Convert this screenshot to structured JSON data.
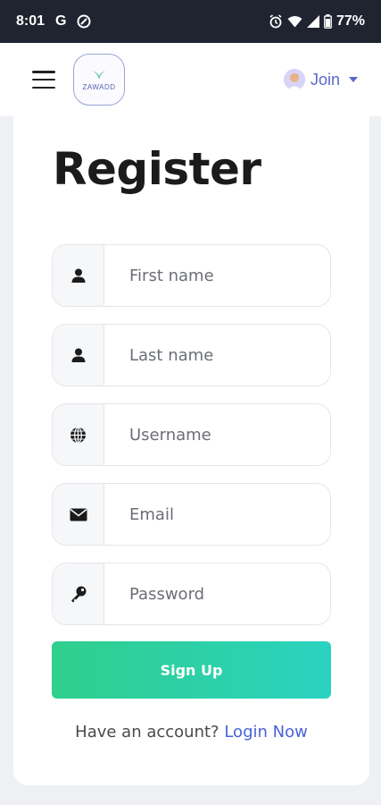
{
  "status_bar": {
    "time": "8:01",
    "g_icon_label": "G",
    "battery": "77%"
  },
  "header": {
    "logo_text": "ZAWADD",
    "join_label": "Join",
    "brand_color": "#5b67c9"
  },
  "form": {
    "title": "Register",
    "fields": [
      {
        "placeholder": "First name",
        "icon": "user-icon"
      },
      {
        "placeholder": "Last name",
        "icon": "user-icon"
      },
      {
        "placeholder": "Username",
        "icon": "globe-icon"
      },
      {
        "placeholder": "Email",
        "icon": "envelope-icon"
      },
      {
        "placeholder": "Password",
        "icon": "key-icon"
      }
    ],
    "signup_label": "Sign Up",
    "have_account_text": "Have an account?",
    "login_link": "Login Now",
    "accent_gradient": [
      "#2fcf8c",
      "#2bd2c0"
    ]
  }
}
